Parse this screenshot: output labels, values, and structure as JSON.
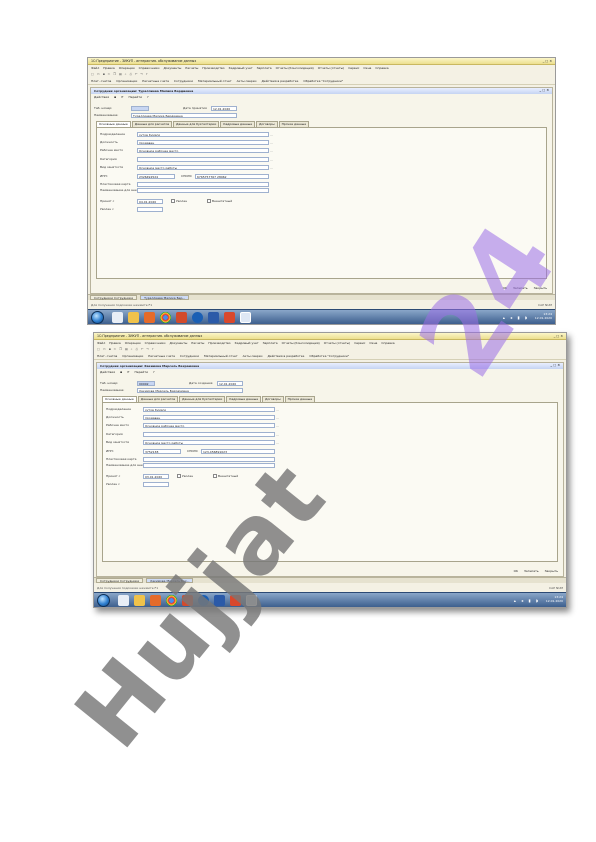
{
  "app_title": "1С:Предприятие - ЗИКУП - интерактив. обслуживание данных",
  "menu": [
    "Файл",
    "Правка",
    "Операции",
    "Справочники",
    "Документы",
    "Расчеты",
    "Производство",
    "Кадровый учет",
    "Зарплата",
    "Отчеты (Консолидация)",
    "Отчеты (отчеты)",
    "Сервис",
    "Окна",
    "Справка"
  ],
  "panel": [
    "Плат. счетов",
    "Организации",
    "Расчетные счета",
    "Сотрудники",
    "Материальный отчет",
    "Акты сверки",
    "Действия в разработке",
    "Обработка \"Сотрудники\""
  ],
  "doc_actions": [
    "Действия",
    "Перейти"
  ],
  "screens": [
    {
      "doc_title": "Сотрудник организации: Тураллиева Малика Бердиевна",
      "tab_number": "",
      "date_label": "Дата принятия",
      "date": "12.01.2020",
      "name": "Тураллиева Малика Бердиевна",
      "tabs": [
        "Основные данные",
        "Данные для расчетов",
        "Данные для бухгалтерии",
        "Кадровые данные",
        "Договоры",
        "Прочие данные"
      ],
      "fields": [
        {
          "label": "Подразделение",
          "value": "хутов бумаги"
        },
        {
          "label": "Должность",
          "value": "продавец"
        },
        {
          "label": "Рабочее место",
          "value": "Основное рабочее место"
        },
        {
          "label": "Категория",
          "value": ""
        },
        {
          "label": "Вид занятости",
          "value": "Основное место работы"
        }
      ],
      "inn": "2326492524",
      "snils_label": "СНИЛС",
      "snils": "6765757767 28962",
      "extra_labels": [
        "Пластиковая карта",
        "Наименование для анкеты АИПС"
      ],
      "hired_label": "Принят с",
      "hired": "04.01.2020",
      "dismissed_label": "Уволен с",
      "dismissed": "",
      "checkbox1": "Уволен",
      "checkbox2": "Внештатный",
      "footer_buttons": [
        "OK",
        "Записать",
        "Закрыть"
      ],
      "window_list": [
        "Сотрудники Сотрудники",
        "Тураллиева Малика Бер..."
      ],
      "status": "Для получения подсказки нажмите F1",
      "capnum": "CAP NUM",
      "clock_time": "13:24",
      "clock_date": "12.01.2020"
    },
    {
      "doc_title": "Сотрудник организации: Хакимова Марсель Бахрамовна",
      "tab_number": "00002",
      "date_label": "Дата создания",
      "date": "12.01.2020",
      "name": "Хакимова Марсель Бахрамовна",
      "tabs": [
        "Основные данные",
        "Данные для расчетов",
        "Данные для бухгалтерии",
        "Кадровые данные",
        "Договоры",
        "Прочие данные"
      ],
      "fields": [
        {
          "label": "Подразделение",
          "value": "хутов бумаги"
        },
        {
          "label": "Должность",
          "value": "продавец"
        },
        {
          "label": "Рабочее место",
          "value": "Основное рабочее место"
        },
        {
          "label": "Категория",
          "value": ""
        },
        {
          "label": "Вид занятости",
          "value": "Основное место работы"
        }
      ],
      "inn": "3752138",
      "snils_label": "СНИЛС",
      "snils": "123-456891023",
      "extra_labels": [
        "Пластиковая карта",
        "Наименование для анкеты АИПС"
      ],
      "hired_label": "Принят с",
      "hired": "03.01.2020",
      "dismissed_label": "Уволен с",
      "dismissed": "",
      "checkbox1": "Уволен",
      "checkbox2": "Внештатный",
      "footer_buttons": [
        "OK",
        "Записать",
        "Закрыть"
      ],
      "window_list": [
        "Сотрудники Сотрудники",
        "Хакимова Марсель Бах..."
      ],
      "status": "Для получения подсказки нажмите F1",
      "capnum": "CAP NUM",
      "clock_time": "13:24",
      "clock_date": "12.01.2020"
    }
  ],
  "colors": {
    "watermark_purple": "#9b6ee6",
    "watermark_gray": "#787878",
    "taskbar": "#3d5f8e"
  },
  "watermarks": [
    "24",
    "Hujjat"
  ]
}
